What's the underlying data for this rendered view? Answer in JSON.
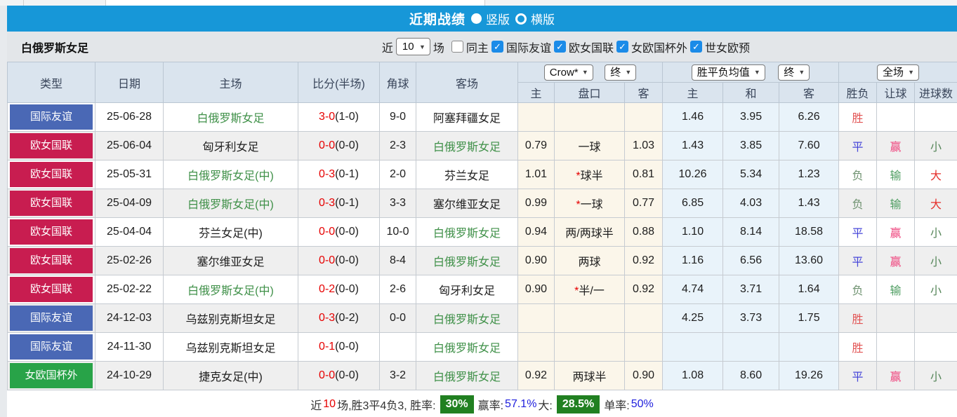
{
  "title_bar": {
    "title": "近期战绩",
    "layout_options": [
      {
        "label": "竖版",
        "selected": true
      },
      {
        "label": "横版",
        "selected": false
      }
    ]
  },
  "filter_bar": {
    "team": "白俄罗斯女足",
    "near_label": "近",
    "matches_value": "10",
    "matches_label": "场",
    "same_home": {
      "label": "同主",
      "checked": false
    },
    "league_filters": [
      {
        "label": "国际友谊",
        "checked": true
      },
      {
        "label": "欧女国联",
        "checked": true
      },
      {
        "label": "女欧国杯外",
        "checked": true
      },
      {
        "label": "世女欧预",
        "checked": true
      }
    ]
  },
  "table": {
    "headers_left": [
      "类型",
      "日期",
      "主场",
      "比分(半场)",
      "角球",
      "客场"
    ],
    "selects": {
      "bookmaker": "Crow*",
      "bookmaker_stage": "终",
      "odds_type": "胜平负均值",
      "odds_stage": "终",
      "scope": "全场"
    },
    "headers_sub": [
      "主",
      "盘口",
      "客",
      "主",
      "和",
      "客",
      "胜负",
      "让球",
      "进球数"
    ],
    "type_colors": {
      "国际友谊": "#4a68b5",
      "欧女国联": "#c81d50",
      "女欧国杯外": "#28a348"
    },
    "result_colors": {
      "胜": "#e25353",
      "平": "#4646d9",
      "负": "#6f9270",
      "赢": "#ef447d",
      "输": "#4f9e62",
      "大": "#e5302c",
      "小": "#56865a"
    },
    "rows": [
      {
        "type": "国际友谊",
        "date": "25-06-28",
        "home": "白俄罗斯女足",
        "home_green": true,
        "score_ft": "3-0",
        "score_ht": "(1-0)",
        "corner": "9-0",
        "away": "阿塞拜疆女足",
        "away_green": false,
        "ah_home": "",
        "ah_line": "",
        "ah_away": "",
        "avg_home": "1.46",
        "avg_draw": "3.95",
        "avg_away": "6.26",
        "res_outcome": "胜",
        "res_handicap": "",
        "res_goals": ""
      },
      {
        "type": "欧女国联",
        "date": "25-06-04",
        "home": "匈牙利女足",
        "home_green": false,
        "score_ft": "0-0",
        "score_ht": "(0-0)",
        "corner": "2-3",
        "away": "白俄罗斯女足",
        "away_green": true,
        "ah_home": "0.79",
        "ah_line": "一球",
        "ah_away": "1.03",
        "avg_home": "1.43",
        "avg_draw": "3.85",
        "avg_away": "7.60",
        "res_outcome": "平",
        "res_handicap": "赢",
        "res_goals": "小"
      },
      {
        "type": "欧女国联",
        "date": "25-05-31",
        "home": "白俄罗斯女足(中)",
        "home_green": true,
        "score_ft": "0-3",
        "score_ht": "(0-1)",
        "corner": "2-0",
        "away": "芬兰女足",
        "away_green": false,
        "ah_home": "1.01",
        "ah_line": "*球半",
        "ah_away": "0.81",
        "avg_home": "10.26",
        "avg_draw": "5.34",
        "avg_away": "1.23",
        "res_outcome": "负",
        "res_handicap": "输",
        "res_goals": "大"
      },
      {
        "type": "欧女国联",
        "date": "25-04-09",
        "home": "白俄罗斯女足(中)",
        "home_green": true,
        "score_ft": "0-3",
        "score_ht": "(0-1)",
        "corner": "3-3",
        "away": "塞尔维亚女足",
        "away_green": false,
        "ah_home": "0.99",
        "ah_line": "*一球",
        "ah_away": "0.77",
        "avg_home": "6.85",
        "avg_draw": "4.03",
        "avg_away": "1.43",
        "res_outcome": "负",
        "res_handicap": "输",
        "res_goals": "大"
      },
      {
        "type": "欧女国联",
        "date": "25-04-04",
        "home": "芬兰女足(中)",
        "home_green": false,
        "score_ft": "0-0",
        "score_ht": "(0-0)",
        "corner": "10-0",
        "away": "白俄罗斯女足",
        "away_green": true,
        "ah_home": "0.94",
        "ah_line": "两/两球半",
        "ah_away": "0.88",
        "avg_home": "1.10",
        "avg_draw": "8.14",
        "avg_away": "18.58",
        "res_outcome": "平",
        "res_handicap": "赢",
        "res_goals": "小"
      },
      {
        "type": "欧女国联",
        "date": "25-02-26",
        "home": "塞尔维亚女足",
        "home_green": false,
        "score_ft": "0-0",
        "score_ht": "(0-0)",
        "corner": "8-4",
        "away": "白俄罗斯女足",
        "away_green": true,
        "ah_home": "0.90",
        "ah_line": "两球",
        "ah_away": "0.92",
        "avg_home": "1.16",
        "avg_draw": "6.56",
        "avg_away": "13.60",
        "res_outcome": "平",
        "res_handicap": "赢",
        "res_goals": "小"
      },
      {
        "type": "欧女国联",
        "date": "25-02-22",
        "home": "白俄罗斯女足(中)",
        "home_green": true,
        "score_ft": "0-2",
        "score_ht": "(0-0)",
        "corner": "2-6",
        "away": "匈牙利女足",
        "away_green": false,
        "ah_home": "0.90",
        "ah_line": "*半/一",
        "ah_away": "0.92",
        "avg_home": "4.74",
        "avg_draw": "3.71",
        "avg_away": "1.64",
        "res_outcome": "负",
        "res_handicap": "输",
        "res_goals": "小"
      },
      {
        "type": "国际友谊",
        "date": "24-12-03",
        "home": "乌兹别克斯坦女足",
        "home_green": false,
        "score_ft": "0-3",
        "score_ht": "(0-2)",
        "corner": "0-0",
        "away": "白俄罗斯女足",
        "away_green": true,
        "ah_home": "",
        "ah_line": "",
        "ah_away": "",
        "avg_home": "4.25",
        "avg_draw": "3.73",
        "avg_away": "1.75",
        "res_outcome": "胜",
        "res_handicap": "",
        "res_goals": ""
      },
      {
        "type": "国际友谊",
        "date": "24-11-30",
        "home": "乌兹别克斯坦女足",
        "home_green": false,
        "score_ft": "0-1",
        "score_ht": "(0-0)",
        "corner": "",
        "away": "白俄罗斯女足",
        "away_green": true,
        "ah_home": "",
        "ah_line": "",
        "ah_away": "",
        "avg_home": "",
        "avg_draw": "",
        "avg_away": "",
        "res_outcome": "胜",
        "res_handicap": "",
        "res_goals": ""
      },
      {
        "type": "女欧国杯外",
        "date": "24-10-29",
        "home": "捷克女足(中)",
        "home_green": false,
        "score_ft": "0-0",
        "score_ht": "(0-0)",
        "corner": "3-2",
        "away": "白俄罗斯女足",
        "away_green": true,
        "ah_home": "0.92",
        "ah_line": "两球半",
        "ah_away": "0.90",
        "avg_home": "1.08",
        "avg_draw": "8.60",
        "avg_away": "19.26",
        "res_outcome": "平",
        "res_handicap": "赢",
        "res_goals": "小"
      }
    ]
  },
  "summary": {
    "segments": [
      {
        "text": "近",
        "style": "plain"
      },
      {
        "text": "10",
        "style": "red"
      },
      {
        "text": "场,胜3平4负3, 胜率:",
        "style": "plain"
      },
      {
        "text": "30%",
        "style": "badge"
      },
      {
        "text": " 赢率:",
        "style": "plain"
      },
      {
        "text": "57.1%",
        "style": "blue"
      },
      {
        "text": " 大:",
        "style": "plain"
      },
      {
        "text": "28.5%",
        "style": "badge"
      },
      {
        "text": " 单率:",
        "style": "plain"
      },
      {
        "text": "50%",
        "style": "blue"
      }
    ]
  },
  "colors": {
    "accent_blue": "#1797d8",
    "header_cell": "#dae4ee",
    "row_alt": "#efefef",
    "handicap_col": "#fbf6ea",
    "avg_col": "#e9f3fa",
    "score_red": "#e60000",
    "team_green": "#3f9048",
    "summary_badge_green": "#218021",
    "checkbox_blue": "#1b8be8"
  }
}
